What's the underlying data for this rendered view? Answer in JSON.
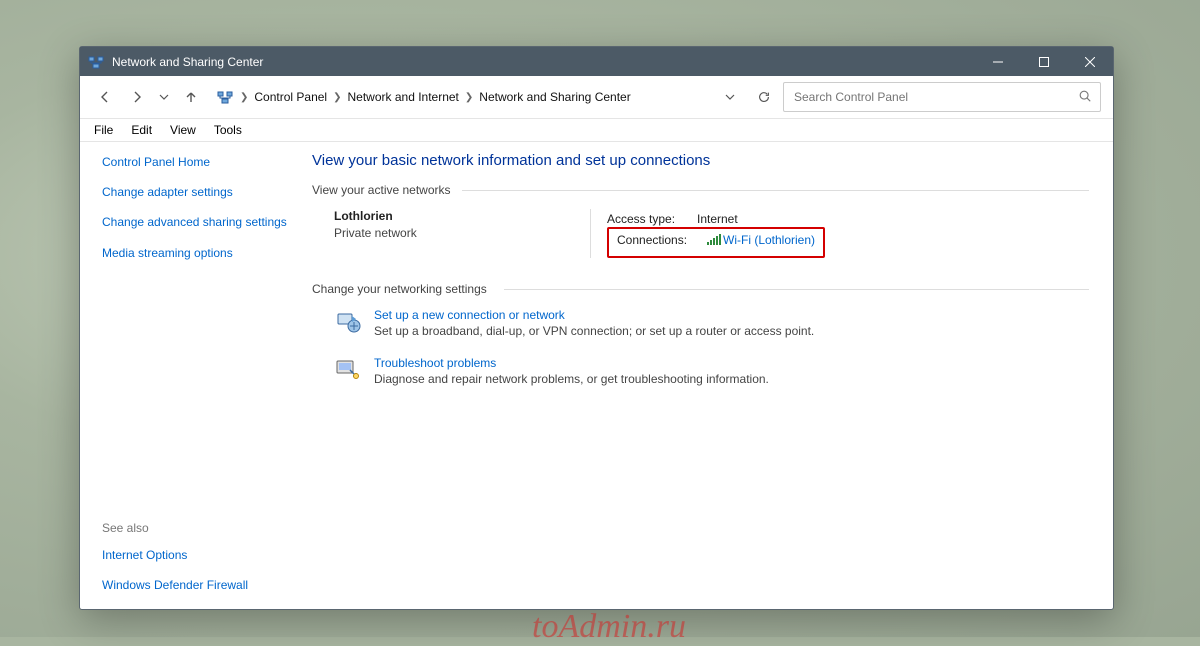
{
  "watermark": "toAdmin.ru",
  "titlebar": {
    "title": "Network and Sharing Center"
  },
  "breadcrumb": {
    "items": [
      "Control Panel",
      "Network and Internet",
      "Network and Sharing Center"
    ]
  },
  "search": {
    "placeholder": "Search Control Panel"
  },
  "menu": {
    "items": [
      "File",
      "Edit",
      "View",
      "Tools"
    ]
  },
  "sidebar": {
    "links": [
      "Control Panel Home",
      "Change adapter settings",
      "Change advanced sharing settings",
      "Media streaming options"
    ],
    "see_also_label": "See also",
    "see_also": [
      "Internet Options",
      "Windows Defender Firewall"
    ]
  },
  "content": {
    "heading": "View your basic network information and set up connections",
    "active_networks_label": "View your active networks",
    "network": {
      "name": "Lothlorien",
      "type": "Private network",
      "access_label": "Access type:",
      "access_value": "Internet",
      "conn_label": "Connections:",
      "conn_value": "Wi-Fi (Lothlorien)"
    },
    "change_settings_label": "Change your networking settings",
    "tasks": [
      {
        "title": "Set up a new connection or network",
        "desc": "Set up a broadband, dial-up, or VPN connection; or set up a router or access point."
      },
      {
        "title": "Troubleshoot problems",
        "desc": "Diagnose and repair network problems, or get troubleshooting information."
      }
    ]
  }
}
